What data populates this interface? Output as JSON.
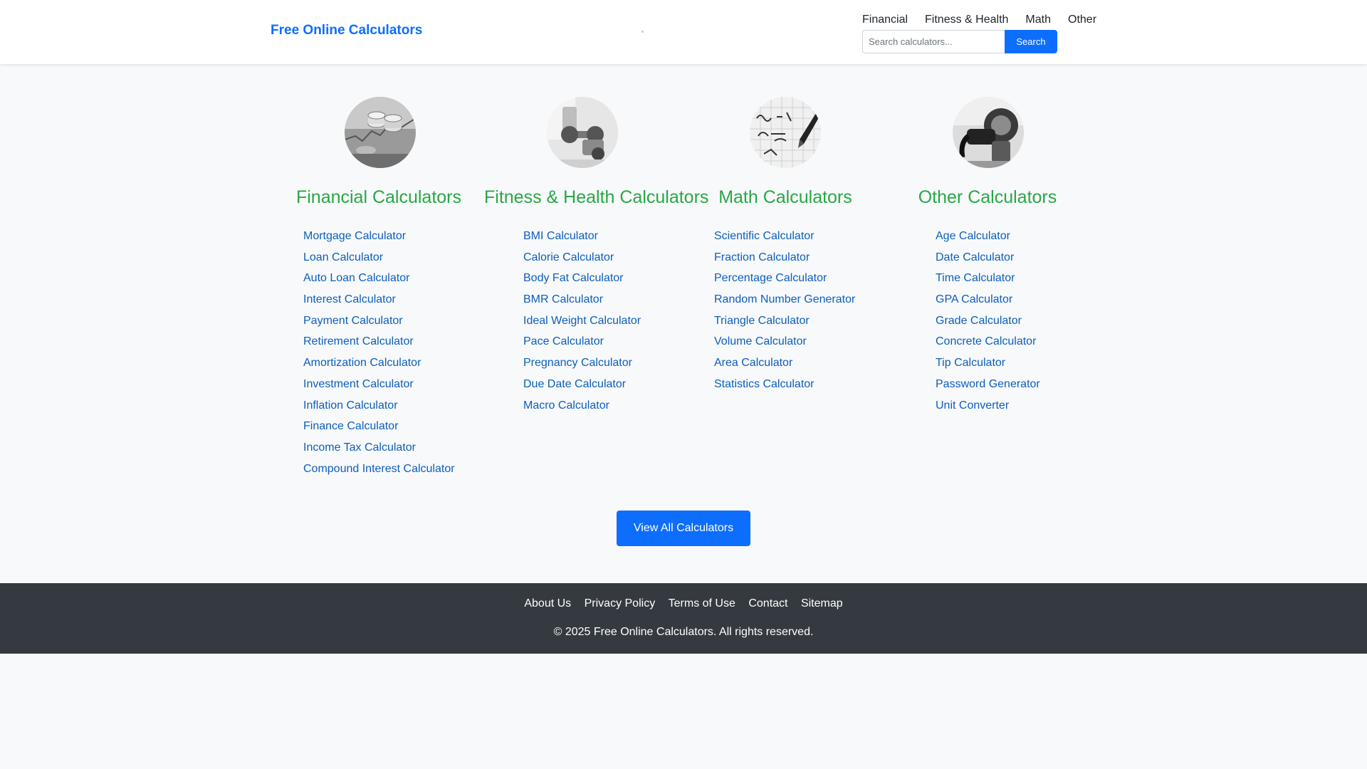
{
  "header": {
    "brand": "Free Online Calculators",
    "nav": [
      "Financial",
      "Fitness & Health",
      "Math",
      "Other"
    ],
    "search_placeholder": "Search calculators...",
    "search_button": "Search"
  },
  "categories": [
    {
      "title": "Financial Calculators",
      "image_icon": "coins-chart-image",
      "links": [
        "Mortgage Calculator",
        "Loan Calculator",
        "Auto Loan Calculator",
        "Interest Calculator",
        "Payment Calculator",
        "Retirement Calculator",
        "Amortization Calculator",
        "Investment Calculator",
        "Inflation Calculator",
        "Finance Calculator",
        "Income Tax Calculator",
        "Compound Interest Calculator"
      ]
    },
    {
      "title": "Fitness & Health Calculators",
      "image_icon": "dumbbell-image",
      "links": [
        "BMI Calculator",
        "Calorie Calculator",
        "Body Fat Calculator",
        "BMR Calculator",
        "Ideal Weight Calculator",
        "Pace Calculator",
        "Pregnancy Calculator",
        "Due Date Calculator",
        "Macro Calculator"
      ]
    },
    {
      "title": "Math Calculators",
      "image_icon": "math-formula-image",
      "links": [
        "Scientific Calculator",
        "Fraction Calculator",
        "Percentage Calculator",
        "Random Number Generator",
        "Triangle Calculator",
        "Volume Calculator",
        "Area Calculator",
        "Statistics Calculator"
      ]
    },
    {
      "title": "Other Calculators",
      "image_icon": "fuel-pump-image",
      "links": [
        "Age Calculator",
        "Date Calculator",
        "Time Calculator",
        "GPA Calculator",
        "Grade Calculator",
        "Concrete Calculator",
        "Tip Calculator",
        "Password Generator",
        "Unit Converter"
      ]
    }
  ],
  "view_all_button": "View All Calculators",
  "footer": {
    "links": [
      "About Us",
      "Privacy Policy",
      "Terms of Use",
      "Contact",
      "Sitemap"
    ],
    "copyright": "© 2025 Free Online Calculators. All rights reserved."
  },
  "colors": {
    "brand": "#0d6efd",
    "category_title": "#28a745",
    "link": "#0b5fbd",
    "footer_bg": "#343a40",
    "page_bg": "#f8f9fa"
  }
}
